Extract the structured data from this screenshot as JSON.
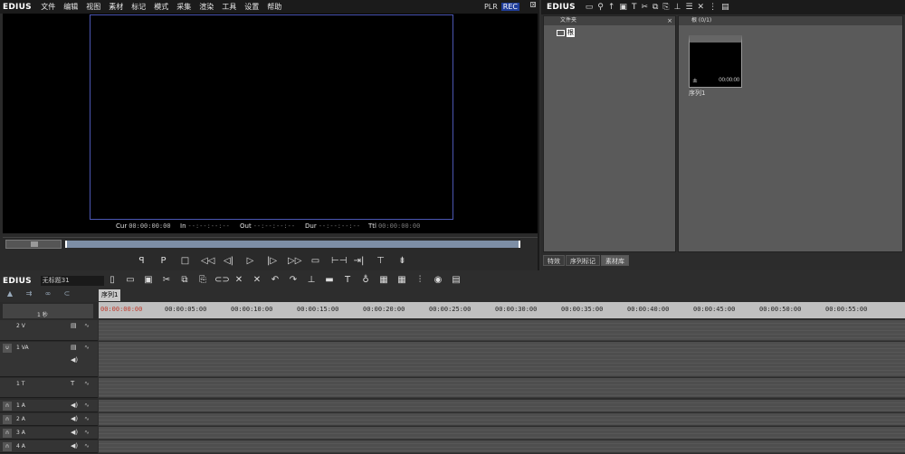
{
  "player": {
    "logo": "EDIUS",
    "menu": [
      "文件",
      "编辑",
      "视图",
      "素材",
      "标记",
      "模式",
      "采集",
      "渲染",
      "工具",
      "设置",
      "帮助"
    ],
    "plr": "PLR",
    "rec": "REC",
    "timecodes": {
      "cur_label": "Cur",
      "cur_value": "00:00:00:00",
      "in_label": "In",
      "in_value": "--:--:--:--",
      "out_label": "Out",
      "out_value": "--:--:--:--",
      "dur_label": "Dur",
      "dur_value": "--:--:--:--",
      "ttl_label": "Ttl",
      "ttl_value": "00:00:00:00"
    }
  },
  "bin": {
    "logo": "EDIUS",
    "folder_header": "文件夹",
    "root_label": "根",
    "clip_header": "根 (0/1)",
    "clip_name": "序列1",
    "thumb_mark": "±",
    "thumb_tc": "00:00:00",
    "tabs": [
      "特效",
      "序列标记",
      "素材库"
    ]
  },
  "timeline": {
    "logo": "EDIUS",
    "sequence_name": "无标题31",
    "sequence_tab": "序列1",
    "zoom_label": "1 秒",
    "ruler": [
      "00:00:00:00",
      "00:00:05:00",
      "00:00:10:00",
      "00:00:15:00",
      "00:00:20:00",
      "00:00:25:00",
      "00:00:30:00",
      "00:00:35:00",
      "00:00:40:00",
      "00:00:45:00",
      "00:00:50:00",
      "00:00:55:00"
    ],
    "tracks": [
      {
        "name": "2 V",
        "icon": "video-track-icon"
      },
      {
        "name": "1 VA",
        "icon": "video-audio-track-icon"
      },
      {
        "name": "1 T",
        "icon": "title-track-icon"
      },
      {
        "name": "1 A",
        "icon": "speaker-icon"
      },
      {
        "name": "2 A",
        "icon": "speaker-icon"
      },
      {
        "name": "3 A",
        "icon": "speaker-icon"
      },
      {
        "name": "4 A",
        "icon": "speaker-icon"
      }
    ]
  }
}
